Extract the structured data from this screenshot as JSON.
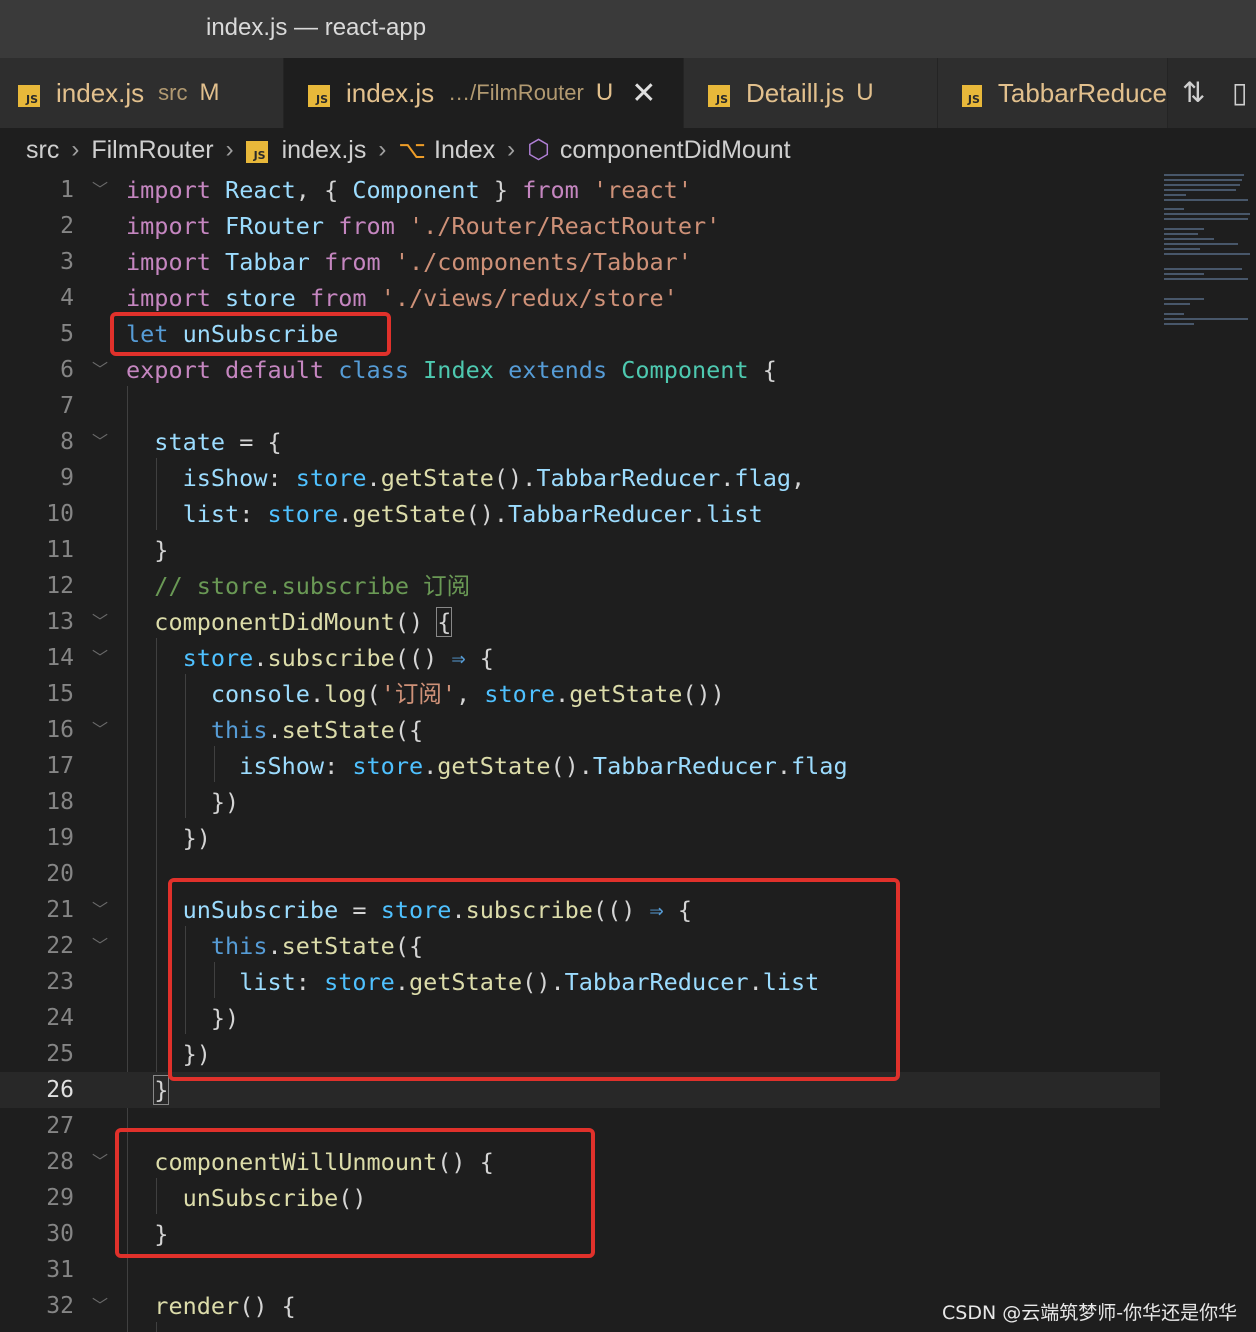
{
  "window": {
    "title": "index.js — react-app"
  },
  "tabs": [
    {
      "name": "index.js",
      "path": "src",
      "status": "M",
      "active": false
    },
    {
      "name": "index.js",
      "path": "…/FilmRouter",
      "status": "U",
      "active": true,
      "close": "✕"
    },
    {
      "name": "Detaill.js",
      "path": "",
      "status": "U",
      "active": false
    },
    {
      "name": "TabbarReduce",
      "path": "",
      "status": "",
      "active": false
    }
  ],
  "tab_actions": {
    "compare_icon": "git-compare-icon",
    "split_icon": "split-editor-icon"
  },
  "breadcrumb": [
    "src",
    "FilmRouter",
    "index.js",
    "Index",
    "componentDidMount"
  ],
  "editor": {
    "current_line": 26,
    "lines": [
      {
        "n": "1"
      },
      {
        "n": "2"
      },
      {
        "n": "3"
      },
      {
        "n": "4"
      },
      {
        "n": "5"
      },
      {
        "n": "6"
      },
      {
        "n": "7"
      },
      {
        "n": "8"
      },
      {
        "n": "9"
      },
      {
        "n": "10"
      },
      {
        "n": "11"
      },
      {
        "n": "12"
      },
      {
        "n": "13"
      },
      {
        "n": "14"
      },
      {
        "n": "15"
      },
      {
        "n": "16"
      },
      {
        "n": "17"
      },
      {
        "n": "18"
      },
      {
        "n": "19"
      },
      {
        "n": "20"
      },
      {
        "n": "21"
      },
      {
        "n": "22"
      },
      {
        "n": "23"
      },
      {
        "n": "24"
      },
      {
        "n": "25"
      },
      {
        "n": "26"
      },
      {
        "n": "27"
      },
      {
        "n": "28"
      },
      {
        "n": "29"
      },
      {
        "n": "30"
      },
      {
        "n": "31"
      },
      {
        "n": "32"
      }
    ],
    "code": [
      "import React, { Component } from 'react'",
      "import FRouter from './Router/ReactRouter'",
      "import Tabbar from './components/Tabbar'",
      "import store from './views/redux/store'",
      "let unSubscribe",
      "export default class Index extends Component {",
      "",
      "  state = {",
      "    isShow: store.getState().TabbarReducer.flag,",
      "    list: store.getState().TabbarReducer.list",
      "  }",
      "  // store.subscribe 订阅",
      "  componentDidMount() {",
      "    store.subscribe(() ⇒ {",
      "      console.log('订阅', store.getState())",
      "      this.setState({",
      "        isShow: store.getState().TabbarReducer.flag",
      "      })",
      "    })",
      "",
      "    unSubscribe = store.subscribe(() ⇒ {",
      "      this.setState({",
      "        list: store.getState().TabbarReducer.list",
      "      })",
      "    })",
      "  }",
      "",
      "  componentWillUnmount() {",
      "    unSubscribe()",
      "  }",
      "",
      "  render() {"
    ]
  },
  "watermark": "CSDN @云端筑梦师-你华还是你华"
}
